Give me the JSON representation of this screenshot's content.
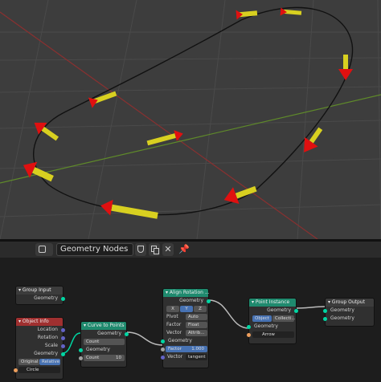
{
  "header": {
    "tree_name": "Geometry Nodes"
  },
  "nodes": {
    "group_input": {
      "title": "Group Input",
      "outputs": [
        "Geometry"
      ]
    },
    "object_info": {
      "title": "Object Info",
      "outputs": [
        "Location",
        "Rotation",
        "Scale",
        "Geometry"
      ],
      "toggle": [
        "Original",
        "Relative"
      ],
      "object": "Circle"
    },
    "curve_to_points": {
      "title": "Curve to Points",
      "outputs": [
        "Geometry"
      ],
      "mode": "Count",
      "input": "Geometry",
      "count_label": "Count",
      "count_value": "10"
    },
    "align_rotation": {
      "title": "Align Rotation ...",
      "output": "Geometry",
      "axes": [
        "X",
        "Y",
        "Z"
      ],
      "pivot_label": "Pivot",
      "pivot_value": "Auto",
      "factor_label": "Factor",
      "factor_value": "Float",
      "vector_label": "Vector",
      "vector_value": "Attrib...",
      "input": "Geometry",
      "factor_field_label": "Factor",
      "factor_field_value": "1.000",
      "vector_field_label": "Vector",
      "vector_field_value": "tangent"
    },
    "point_instance": {
      "title": "Point Instance",
      "output": "Geometry",
      "tabs": [
        "Object",
        "Collecti..."
      ],
      "input": "Geometry",
      "object": "Arrow"
    },
    "group_output": {
      "title": "Group Output",
      "inputs": [
        "Geometry",
        "Geometry"
      ]
    }
  },
  "colors": {
    "viewport_bg": "#3d3d3d",
    "curve": "#111111",
    "arrow_red": "#e01010",
    "arrow_yellow": "#d8d020"
  }
}
